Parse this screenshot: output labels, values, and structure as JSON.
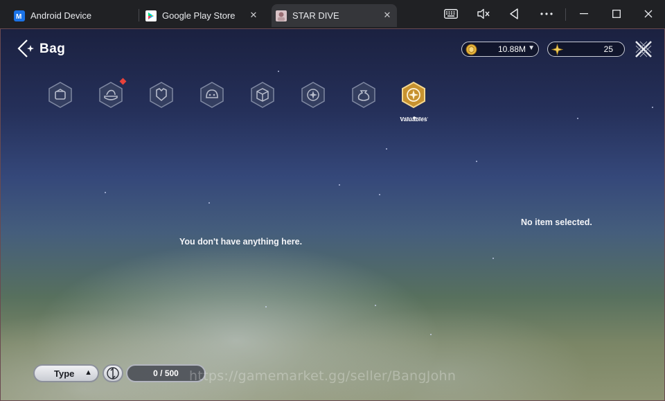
{
  "browser": {
    "tabs": [
      {
        "label": "Android Device",
        "icon": "android-device-icon",
        "accent": "#1a73e8"
      },
      {
        "label": "Google Play Store",
        "icon": "google-play-icon"
      },
      {
        "label": "STAR DIVE",
        "icon": "star-dive-favicon"
      }
    ],
    "tab_close_glyph": "✕",
    "controls": [
      "keyboard-icon",
      "mute-icon",
      "back-nav-icon",
      "more-icon",
      "minimize-icon",
      "maximize-icon",
      "close-icon"
    ]
  },
  "game": {
    "title": "Bag",
    "currencies": [
      {
        "icon": "gold-coin-icon",
        "value": "10.88M",
        "has_dropdown": true,
        "color": "#e6b53a"
      },
      {
        "icon": "star-crystal-icon",
        "value": "25",
        "has_dropdown": false,
        "color": "#f2cf5c"
      }
    ],
    "categories": [
      {
        "icon": "equipment-icon",
        "active": false,
        "badge": false
      },
      {
        "icon": "food-icon",
        "active": false,
        "badge": true
      },
      {
        "icon": "armor-icon",
        "active": false,
        "badge": false
      },
      {
        "icon": "consumable-icon",
        "active": false,
        "badge": false
      },
      {
        "icon": "materials-icon",
        "active": false,
        "badge": false
      },
      {
        "icon": "special-icon",
        "active": false,
        "badge": false
      },
      {
        "icon": "pouch-icon",
        "active": false,
        "badge": false
      },
      {
        "icon": "valuables-icon",
        "active": true,
        "badge": false,
        "label": "Valuables"
      }
    ],
    "empty_message": "You don't have anything here.",
    "detail_message": "No item selected.",
    "filter": {
      "label": "Type",
      "arrow": "▲"
    },
    "capacity": "0 / 500",
    "watermark": "https://gamemarket.gg/seller/BangJohn",
    "colors": {
      "accent_gold": "#d9a73c",
      "badge_red": "#e8423a"
    }
  }
}
